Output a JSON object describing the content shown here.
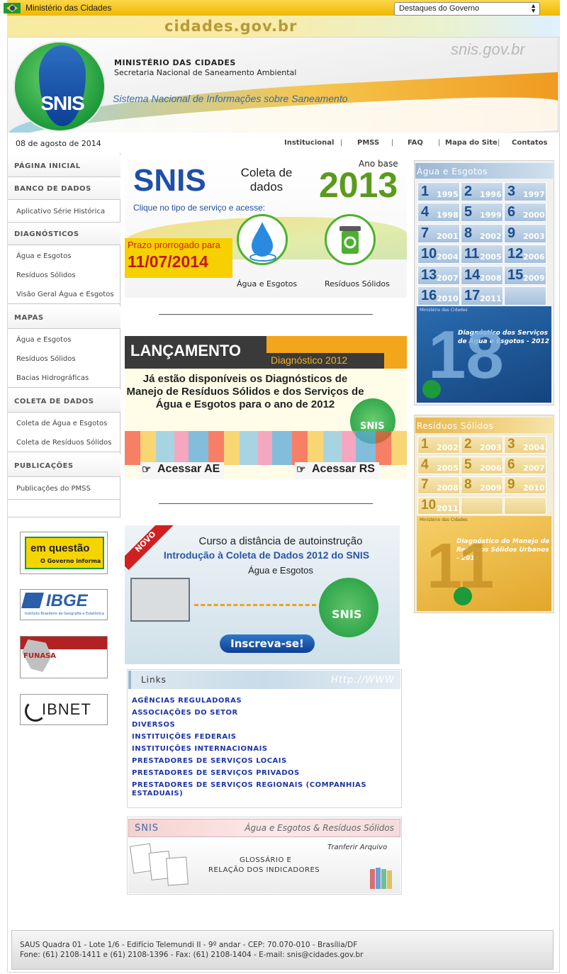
{
  "gov_bar": {
    "ministry_label": "Ministério das Cidades",
    "select_value": "Destaques do Governo",
    "domain_text": "cidades.gov.br"
  },
  "header": {
    "logo_text": "SNIS",
    "ministry": "MINISTÉRIO DAS CIDADES",
    "secretariat": "Secretaria Nacional de Saneamento Ambiental",
    "system_name": "Sistema Nacional de Informações sobre Saneamento",
    "site_domain": "snis.gov.br"
  },
  "date": "08 de agosto de 2014",
  "top_nav": {
    "items": [
      "Institucional",
      "PMSS",
      "FAQ",
      "Mapa do Site",
      "Contatos"
    ]
  },
  "sidebar": {
    "pagina_inicial": "PÁGINA INICIAL",
    "banco_de_dados": "BANCO DE DADOS",
    "aplicativo": "Aplicativo Série Histórica",
    "diagnosticos": "DIAGNÓSTICOS",
    "diag_items": [
      "Água e Esgotos",
      "Resíduos Sólidos",
      "Visão Geral Água e Esgotos"
    ],
    "mapas": "MAPAS",
    "mapas_items": [
      "Água e Esgotos",
      "Resíduos Sólidos",
      "Bacias Hidrográficas"
    ],
    "coleta": "COLETA DE DADOS",
    "coleta_items": [
      "Coleta de Água e Esgotos",
      "Coleta de Resíduos Sólidos"
    ],
    "publicacoes": "PUBLICAÇÕES",
    "pub_items": [
      "Publicações do PMSS"
    ]
  },
  "partners": {
    "em_questao": "em questão",
    "em_questao_sub": "O Governo informa",
    "ibge": "IBGE",
    "ibge_sub": "Instituto Brasileiro de Geografia e Estatística",
    "funasa": "FUNASA",
    "ibnet": "IBNET"
  },
  "banner_coleta": {
    "snis": "SNIS",
    "coleta": "Coleta de dados",
    "ano_base": "Ano base",
    "year": "2013",
    "clique": "Clique no tipo de serviço e acesse:",
    "prazo": "Prazo prorrogado para",
    "prazo_date": "11/07/2014",
    "agua": "Água e Esgotos",
    "residuos": "Resíduos Sólidos"
  },
  "banner_lancamento": {
    "lancamento": "LANÇAMENTO",
    "diagnostico": "Diagnóstico 2012",
    "text": "Já estão disponíveis os Diagnósticos de Manejo de Resíduos Sólidos e dos Serviços de Água e Esgotos para o ano de 2012",
    "snis": "SNIS",
    "btn_ae": "Acessar AE",
    "btn_rs": "Acessar RS"
  },
  "banner_curso": {
    "novo": "NOVO",
    "line1": "Curso a distância de autoinstrução",
    "line2": "Introdução à Coleta de Dados 2012 do SNIS",
    "line3": "Água e Esgotos",
    "snis": "SNIS",
    "cta": "Inscreva-se!"
  },
  "links": {
    "header": "Links",
    "header_right": "Http://WWW",
    "items": [
      "AGÊNCIAS REGULADORAS",
      "ASSOCIAÇÕES DO SETOR",
      "DIVERSOS",
      "INSTITUIÇÕES FEDERAIS",
      "INSTITUIÇÕES INTERNACIONAIS",
      "PRESTADORES DE SERVIÇOS LOCAIS",
      "PRESTADORES DE SERVIÇOS PRIVADOS",
      "PRESTADORES DE SERVIÇOS REGIONAIS (COMPANHIAS",
      "ESTADUAIS)"
    ]
  },
  "glossario": {
    "snis": "SNIS",
    "area": "Água e Esgotos & Resíduos Sólidos",
    "transfer": "Tranferir Arquivo",
    "line1": "GLOSSÁRIO E",
    "line2": "RELAÇÃO DOS INDICADORES"
  },
  "agua_esgotos_panel": {
    "title": "Água e Esgotos",
    "cells": [
      {
        "n": "1",
        "y": "1995"
      },
      {
        "n": "2",
        "y": "1996"
      },
      {
        "n": "3",
        "y": "1997"
      },
      {
        "n": "4",
        "y": "1998"
      },
      {
        "n": "5",
        "y": "1999"
      },
      {
        "n": "6",
        "y": "2000"
      },
      {
        "n": "7",
        "y": "2001"
      },
      {
        "n": "8",
        "y": "2002"
      },
      {
        "n": "9",
        "y": "2003"
      },
      {
        "n": "10",
        "y": "2004"
      },
      {
        "n": "11",
        "y": "2005"
      },
      {
        "n": "12",
        "y": "2006"
      },
      {
        "n": "13",
        "y": "2007"
      },
      {
        "n": "14",
        "y": "2008"
      },
      {
        "n": "15",
        "y": "2009"
      },
      {
        "n": "16",
        "y": "2010"
      },
      {
        "n": "17",
        "y": "2011"
      }
    ],
    "cover_number": "18",
    "cover_ministry": "Ministério das Cidades",
    "cover_title": "Diagnóstico dos Serviços de Água e Esgotos - 2012"
  },
  "residuos_panel": {
    "title": "Resíduos Sólidos",
    "cells": [
      {
        "n": "1",
        "y": "2002"
      },
      {
        "n": "2",
        "y": "2003"
      },
      {
        "n": "3",
        "y": "2004"
      },
      {
        "n": "4",
        "y": "2005"
      },
      {
        "n": "5",
        "y": "2006"
      },
      {
        "n": "6",
        "y": "2007"
      },
      {
        "n": "7",
        "y": "2008"
      },
      {
        "n": "8",
        "y": "2009"
      },
      {
        "n": "9",
        "y": "2010"
      },
      {
        "n": "10",
        "y": "2011"
      }
    ],
    "cover_number": "11",
    "cover_ministry": "Ministério das Cidades",
    "cover_title": "Diagnóstico do Manejo de Resíduos Sólidos Urbanos - 2012"
  },
  "footer": {
    "address": "SAUS Quadra 01 - Lote 1/6 - Edifício Telemundi II - 9º andar - CEP: 70.070-010 - Brasília/DF",
    "contact": "Fone: (61) 2108-1411 e (61) 2108-1396 - Fax: (61) 2108-1404 - E-mail: snis@cidades.gov.br"
  },
  "colors": {
    "gov_yellow": "#f3c000",
    "snis_blue": "#1f4fa8",
    "snis_green": "#1d9a3a",
    "link_blue": "#1d35a8"
  }
}
